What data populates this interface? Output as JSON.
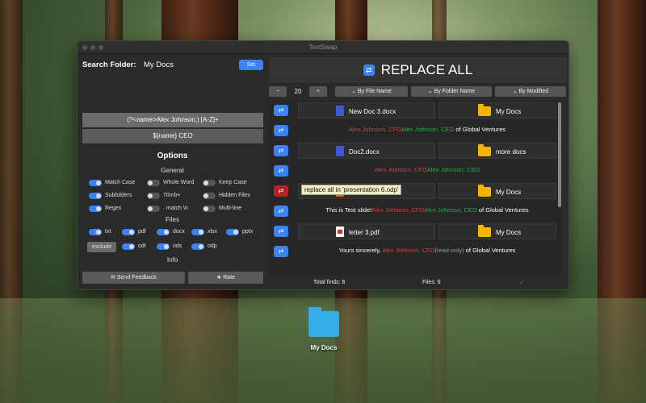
{
  "window": {
    "title": "TextSwap"
  },
  "search": {
    "label": "Search Folder:",
    "value": "My Docs",
    "set_label": "Set"
  },
  "patterns": {
    "find": "(?<name>Alex Johnson,) [A-Z]+",
    "replace": "${name} CEO"
  },
  "options": {
    "title": "Options",
    "general_label": "General",
    "general": [
      {
        "label": "Match Case",
        "on": true
      },
      {
        "label": "Whole Word",
        "on": false
      },
      {
        "label": "Keep Case",
        "on": false
      },
      {
        "label": "Subfolders",
        "on": true
      },
      {
        "label": "70mb+",
        "on": false
      },
      {
        "label": "Hidden Files",
        "on": false
      },
      {
        "label": "Regex",
        "on": true
      },
      {
        "label": ". match \\n",
        "on": false
      },
      {
        "label": "Multi-line",
        "on": false
      }
    ],
    "files_label": "Files",
    "files": [
      {
        "label": "txt",
        "on": true
      },
      {
        "label": "pdf",
        "on": true
      },
      {
        "label": "docx",
        "on": true
      },
      {
        "label": "xlsx",
        "on": true
      },
      {
        "label": "pptx",
        "on": true
      },
      {
        "label": "odt",
        "on": true
      },
      {
        "label": "ods",
        "on": true
      },
      {
        "label": "odp",
        "on": true
      }
    ],
    "exclude_label": "exclude",
    "info_label": "Info"
  },
  "buttons": {
    "feedback": "✉ Send Feedback",
    "rate": "★ Rate"
  },
  "replace_all": {
    "label": "REPLACE ALL"
  },
  "controls": {
    "minus": "−",
    "value": "20",
    "plus": "+",
    "sort_file": "⌄ By File Name",
    "sort_folder": "⌄ By Folder Name",
    "sort_modified": "⌄ By Modified"
  },
  "results": [
    {
      "type": "file",
      "name": "New Doc 3.docx",
      "folder": "My Docs",
      "icon": "docx"
    },
    {
      "type": "line",
      "parts": [
        [
          "red",
          "Alex Johnson, CFO"
        ],
        [
          "green",
          "Alex Johnson, CEO"
        ],
        [
          "white",
          " of Global Ventures"
        ]
      ]
    },
    {
      "type": "file",
      "name": "Doc2.docx",
      "folder": "more docs",
      "icon": "docx"
    },
    {
      "type": "line",
      "parts": [
        [
          "red",
          "Alex Johnson, CFO"
        ],
        [
          "green",
          "Alex Johnson, CEO"
        ]
      ]
    },
    {
      "type": "file",
      "name": "",
      "folder": "My Docs",
      "icon": "pptx",
      "tooltip": "replace all in 'presentation 6.odp'"
    },
    {
      "type": "line",
      "parts": [
        [
          "white",
          "This is Test slide!"
        ],
        [
          "red",
          "Alex Johnson, CFO"
        ],
        [
          "green",
          "Alex Johnson, CEO"
        ],
        [
          "white",
          " of Global Ventures"
        ]
      ]
    },
    {
      "type": "file",
      "name": "letter 3.pdf",
      "folder": "My Docs",
      "icon": "pdf"
    },
    {
      "type": "line",
      "parts": [
        [
          "white",
          "Yours sincerely, "
        ],
        [
          "red",
          "Alex Johnson, CFO"
        ],
        [
          "grey",
          "(read-only)"
        ],
        [
          "white",
          " of Global Ventures"
        ]
      ]
    }
  ],
  "status": {
    "total": "Total finds: 8",
    "files": "Files: 6",
    "check": "✓"
  },
  "desktop": {
    "folder_label": "My Docs"
  },
  "colors": {
    "accent": "#3b82f6",
    "find_red": "#e53935",
    "replace_green": "#2fa84f",
    "folder_yellow": "#f5b400"
  }
}
